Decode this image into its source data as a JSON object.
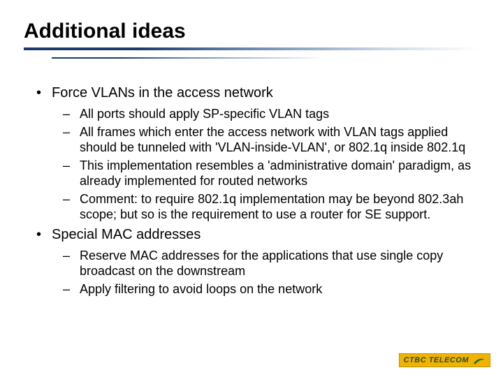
{
  "title": "Additional ideas",
  "bullets": [
    {
      "level": 1,
      "text": "Force VLANs in the access network"
    },
    {
      "level": 2,
      "text": "All ports should apply SP-specific VLAN tags"
    },
    {
      "level": 2,
      "text": "All frames which enter the access network with VLAN tags applied should be tunneled with 'VLAN-inside-VLAN', or 802.1q inside 802.1q"
    },
    {
      "level": 2,
      "text": "This implementation resembles a 'administrative domain' paradigm, as already implemented for routed networks"
    },
    {
      "level": 2,
      "text": "Comment: to require 802.1q implementation may be beyond 802.3ah scope; but so is the requirement to use a router for SE support."
    },
    {
      "level": 1,
      "text": "Special MAC addresses"
    },
    {
      "level": 2,
      "text": "Reserve MAC addresses for the applications that use single copy broadcast on the downstream"
    },
    {
      "level": 2,
      "text": "Apply filtering to avoid loops on the network"
    }
  ],
  "logo": {
    "text": "CTBC TELECOM"
  }
}
